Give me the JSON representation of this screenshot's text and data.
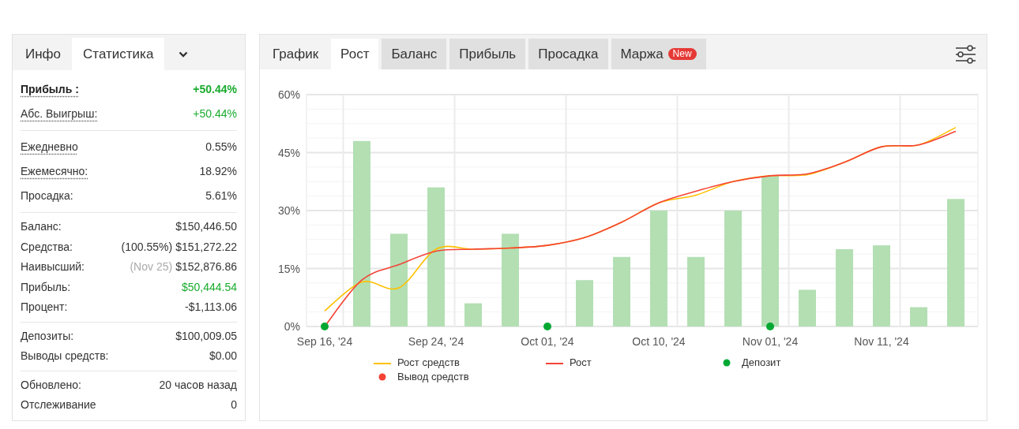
{
  "stats_panel": {
    "tabs": [
      {
        "label": "Инфо",
        "selected": false
      },
      {
        "label": "Статистика",
        "selected": true
      }
    ],
    "groups": [
      {
        "rows": [
          {
            "label": "Прибыль :",
            "value": "+50.44%",
            "bold": true,
            "dotted": true,
            "positive": true
          },
          {
            "label": "Абс. Выигрыш:",
            "value": "+50.44%",
            "bold": false,
            "dotted": true,
            "positive": true
          }
        ]
      },
      {
        "rows": [
          {
            "label": "Ежедневно",
            "value": "0.55%",
            "bold": false,
            "dotted": true,
            "positive": false
          },
          {
            "label": "Ежемесячно:",
            "value": "18.92%",
            "bold": false,
            "dotted": true,
            "positive": false
          },
          {
            "label": "Просадка:",
            "value": "5.61%",
            "bold": false,
            "dotted": false,
            "positive": false
          }
        ]
      },
      {
        "rows": [
          {
            "label": "Баланс:",
            "value": "$150,446.50",
            "bold": false,
            "dotted": false,
            "positive": false
          },
          {
            "label": "Средства:",
            "note": "(100.55%)",
            "value": "$151,272.22",
            "bold": false,
            "dotted": false,
            "positive": false,
            "note_muted": false
          },
          {
            "label": "Наивысший:",
            "note": "(Nov 25)",
            "value": "$152,876.86",
            "bold": false,
            "dotted": false,
            "positive": false,
            "note_muted": true
          },
          {
            "label": "Прибыль:",
            "value": "$50,444.54",
            "bold": false,
            "dotted": false,
            "positive": true
          },
          {
            "label": "Процент:",
            "value": "-$1,113.06",
            "bold": false,
            "dotted": false,
            "positive": false
          }
        ]
      },
      {
        "rows": [
          {
            "label": "Депозиты:",
            "value": "$100,009.05",
            "bold": false,
            "dotted": false,
            "positive": false
          },
          {
            "label": "Выводы средств:",
            "value": "$0.00",
            "bold": false,
            "dotted": false,
            "positive": false
          }
        ]
      },
      {
        "rows": [
          {
            "label": "Обновлено:",
            "value": "20 часов назад",
            "bold": false,
            "dotted": false,
            "positive": false
          },
          {
            "label": "Отслеживание",
            "value": "0",
            "bold": false,
            "dotted": false,
            "positive": false
          }
        ]
      }
    ]
  },
  "chart_panel": {
    "tabs": [
      {
        "label": "График",
        "selected": false,
        "shaded": false
      },
      {
        "label": "Рост",
        "selected": true,
        "shaded": false
      },
      {
        "label": "Баланс",
        "selected": false,
        "shaded": true
      },
      {
        "label": "Прибыль",
        "selected": false,
        "shaded": true
      },
      {
        "label": "Просадка",
        "selected": false,
        "shaded": true
      },
      {
        "label": "Маржа",
        "selected": false,
        "shaded": true,
        "badge": "New"
      }
    ],
    "chart_data": {
      "type": "bar",
      "categories": [
        "Sep 16, '24",
        null,
        null,
        "Sep 24, '24",
        null,
        null,
        "Oct 01, '24",
        null,
        null,
        "Oct 10, '24",
        null,
        null,
        "Nov 01, '24",
        null,
        null,
        "Nov 11, '24",
        null,
        null
      ],
      "ylim": [
        0,
        60
      ],
      "grid": true,
      "legend": "bottom",
      "yticks": [
        {
          "value": 0,
          "label": "0%"
        },
        {
          "value": 15,
          "label": "15%"
        },
        {
          "value": 30,
          "label": "30%"
        },
        {
          "value": 45,
          "label": "45%"
        },
        {
          "value": 60,
          "label": "60%"
        }
      ],
      "series": [
        {
          "type": "bar",
          "color": "#b3dfb3",
          "values": [
            null,
            48,
            24,
            36,
            6,
            24,
            null,
            12,
            18,
            30,
            18,
            30,
            39,
            9.5,
            20,
            21,
            5,
            33
          ]
        },
        {
          "type": "line",
          "name": "Рост средств",
          "color": "#ffc000",
          "values": [
            4,
            11.5,
            10,
            20,
            20,
            20.3,
            21,
            23,
            27,
            32,
            34,
            37.5,
            39,
            39.3,
            42.5,
            46.5,
            47,
            51.5
          ]
        },
        {
          "type": "line",
          "name": "Рост",
          "color": "#f44336",
          "values": [
            0,
            12,
            16,
            19.5,
            20,
            20.3,
            21,
            23,
            27,
            32,
            35,
            37.5,
            39,
            39.5,
            42.5,
            46.5,
            47,
            50.5
          ]
        },
        {
          "type": "scatter",
          "name": "Депозит",
          "color": "#00a832",
          "values": [
            0,
            null,
            null,
            null,
            null,
            null,
            0,
            null,
            null,
            null,
            null,
            null,
            0,
            null,
            null,
            null,
            null,
            null
          ]
        },
        {
          "type": "scatter",
          "name": "Вывод средств",
          "color": "#f44336",
          "values": [
            null,
            null,
            null,
            null,
            null,
            null,
            null,
            null,
            null,
            null,
            null,
            null,
            null,
            null,
            null,
            null,
            null,
            null
          ]
        }
      ]
    }
  }
}
